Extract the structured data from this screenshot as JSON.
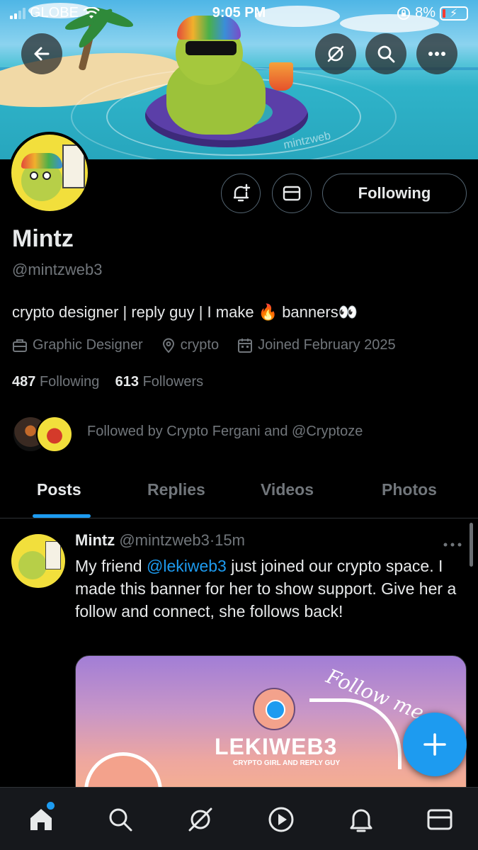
{
  "status_bar": {
    "carrier": "GLOBE",
    "time": "9:05 PM",
    "battery": "8%"
  },
  "banner": {
    "watermark": "mintzweb"
  },
  "profile": {
    "name": "Mintz",
    "handle": "@mintzweb3",
    "bio": "crypto designer | reply guy | I make 🔥 banners👀",
    "category": "Graphic Designer",
    "location": "crypto",
    "joined": "Joined February 2025",
    "following_count": "487",
    "following_label": "Following",
    "followers_count": "613",
    "followers_label": "Followers",
    "followed_by": "Followed by Crypto Fergani and @Cryptoze",
    "follow_button": "Following"
  },
  "tabs": [
    "Posts",
    "Replies",
    "Videos",
    "Photos"
  ],
  "active_tab": "Posts",
  "post": {
    "author": "Mintz",
    "handle": "@mintzweb3",
    "time": "15m",
    "text_before": "My friend ",
    "mention": "@lekiweb3",
    "text_after": " just joined our crypto space. I made this banner for her to show support. Give her a follow and connect, she follows back!",
    "media": {
      "brand": "LEKIWEB3",
      "tagline": "CRYPTO GIRL AND REPLY GUY",
      "handwriting": "Follow me"
    }
  },
  "icons": {
    "back": "arrow-left-icon",
    "grok": "grok-icon",
    "search": "search-icon",
    "more": "more-icon",
    "notify": "bell-plus-icon",
    "message": "envelope-icon"
  },
  "colors": {
    "accent": "#1d9bf0",
    "background": "#000000",
    "muted": "#71767b"
  }
}
